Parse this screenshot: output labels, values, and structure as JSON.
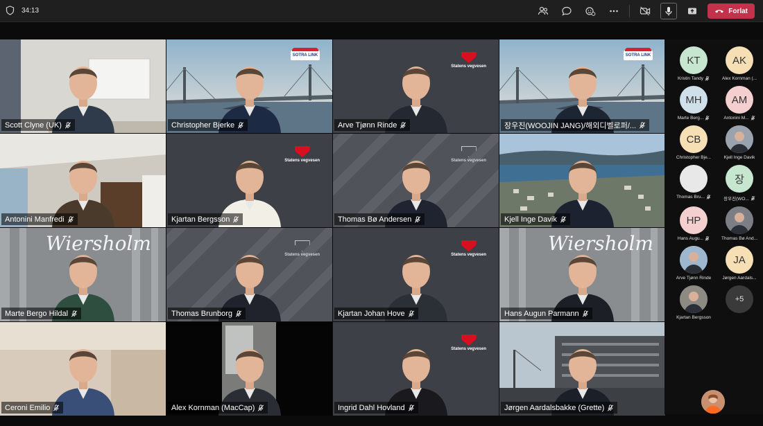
{
  "topbar": {
    "timer": "34:13",
    "leave_label": "Forlat",
    "leave_color": "#c4314b",
    "icons": [
      "shield-icon",
      "people-icon",
      "chat-icon",
      "reactions-icon",
      "more-icon",
      "camera-off-icon",
      "mic-icon",
      "share-screen-icon",
      "phone-hangup-icon"
    ]
  },
  "tiles": [
    {
      "name": "Scott Clyne (UK)",
      "bg": "office",
      "shirt": "#2f3a4a"
    },
    {
      "name": "Christopher Bjerke",
      "bg": "bridge",
      "logo": "SOTRA LINK",
      "shirt": "#1d2a44"
    },
    {
      "name": "Arve Tjønn Rinde",
      "bg": "svv",
      "logo": "Statens vegvesen",
      "shirt": "#232831"
    },
    {
      "name": "장우진(WOOJIN JANG)/해외디벨로퍼/...",
      "bg": "bridge",
      "logo": "SOTRA LINK",
      "shirt": "#1d2533"
    },
    {
      "name": "Antonini Manfredi",
      "bg": "room",
      "shirt": "#4a3a2c"
    },
    {
      "name": "Kjartan Bergsson",
      "bg": "svv",
      "logo": "Statens vegvesen",
      "shirt": "#f2efe6"
    },
    {
      "name": "Thomas Bø Andersen",
      "bg": "svvgrey",
      "logo": "Statens vegvesen",
      "shirt": "#1f2430"
    },
    {
      "name": "Kjell Inge Davik",
      "bg": "city",
      "shirt": "#1c2230"
    },
    {
      "name": "Marte Bergo Hildal",
      "bg": "wiersholm",
      "logo": "Wiersholm",
      "shirt": "#2e4f3f"
    },
    {
      "name": "Thomas Brunborg",
      "bg": "svvgrey",
      "logo": "Statens vegvesen",
      "shirt": "#20232b"
    },
    {
      "name": "Kjartan Johan Hove",
      "bg": "svv",
      "logo": "Statens vegvesen",
      "shirt": "#2b2f36"
    },
    {
      "name": "Hans Augun Parmann",
      "bg": "wiersholm",
      "logo": "Wiersholm",
      "shirt": "#1c1f26"
    },
    {
      "name": "Ceroni Emilio",
      "bg": "warm",
      "shirt": "#3a4f78"
    },
    {
      "name": "Alex Kornman (MacCap)",
      "bg": "dark",
      "shirt": "#2a2d33"
    },
    {
      "name": "Ingrid Dahl Hovland",
      "bg": "svv",
      "logo": "Statens vegvesen",
      "shirt": "#1a1a1e"
    },
    {
      "name": "Jørgen Aardalsbakke (Grette)",
      "bg": "harbor",
      "shirt": "#1b1f28"
    }
  ],
  "participants": [
    {
      "initials": "KT",
      "name": "Kristin Tandy",
      "color": "#c7e6d0",
      "muted": true
    },
    {
      "initials": "AK",
      "name": "Alex Kornman (...",
      "color": "#f6dfb4",
      "muted": false
    },
    {
      "initials": "MH",
      "name": "Marte Berg...",
      "color": "#cfe0ea",
      "muted": true
    },
    {
      "initials": "AM",
      "name": "Antonini M...",
      "color": "#f4cfcf",
      "muted": true
    },
    {
      "initials": "CB",
      "name": "Christopher Bje...",
      "color": "#f6dfb4",
      "muted": false
    },
    {
      "initials": "",
      "name": "Kjell Inge Davik",
      "color": "#9aa3ad",
      "muted": false,
      "photo": true
    },
    {
      "initials": "",
      "name": "Thomas Bru...",
      "color": "#e8e8e8",
      "muted": true,
      "blank": true
    },
    {
      "initials": "장",
      "name": "장우진(WO...",
      "color": "#c7e6d0",
      "muted": true
    },
    {
      "initials": "HP",
      "name": "Hans Augu...",
      "color": "#f4cfcf",
      "muted": true
    },
    {
      "initials": "",
      "name": "Thomas Bø And...",
      "color": "#7b7f85",
      "muted": false,
      "photo": true
    },
    {
      "initials": "",
      "name": "Arve Tjønn Rinde",
      "color": "#9fb6cf",
      "muted": false,
      "photo": true
    },
    {
      "initials": "JA",
      "name": "Jørgen Aardals...",
      "color": "#f6dfb4",
      "muted": false
    },
    {
      "initials": "",
      "name": "Kjartan Bergsson",
      "color": "#8d8a84",
      "muted": false,
      "photo": true
    },
    {
      "initials": "+5",
      "name": "",
      "color": "#3a3a3a",
      "muted": false,
      "more": true
    }
  ]
}
